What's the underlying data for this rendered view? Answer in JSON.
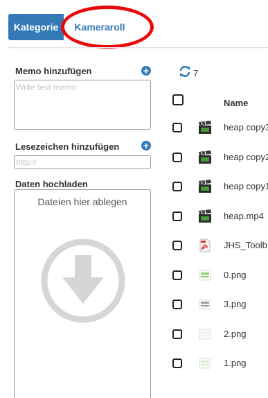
{
  "tabs": {
    "kategorie": "Kategorie",
    "kameraroll": "Kameraroll"
  },
  "memo": {
    "label": "Memo hinzufügen",
    "placeholder": "Write text memo"
  },
  "bookmark": {
    "label": "Lesezeichen hinzufügen",
    "placeholder": "http://"
  },
  "upload": {
    "label": "Daten hochladen",
    "drop_text": "Dateien hier ablegen"
  },
  "file_list": {
    "count": "7",
    "column_name": "Name",
    "files": [
      {
        "name": "heap copy3",
        "icon": "video-clapper-icon"
      },
      {
        "name": "heap copy2",
        "icon": "video-clapper-icon"
      },
      {
        "name": "heap copy1",
        "icon": "video-clapper-icon"
      },
      {
        "name": "heap.mp4",
        "icon": "video-clapper-icon"
      },
      {
        "name": "JHS_Toolb",
        "icon": "pdf-icon"
      },
      {
        "name": "0.png",
        "icon": "image-thumbnail-icon"
      },
      {
        "name": "3.png",
        "icon": "image-thumbnail-icon"
      },
      {
        "name": "2.png",
        "icon": "image-thumbnail-icon"
      },
      {
        "name": "1.png",
        "icon": "image-thumbnail-icon"
      }
    ]
  },
  "colors": {
    "primary": "#337ab7",
    "highlight_ellipse": "#e80a0a"
  }
}
